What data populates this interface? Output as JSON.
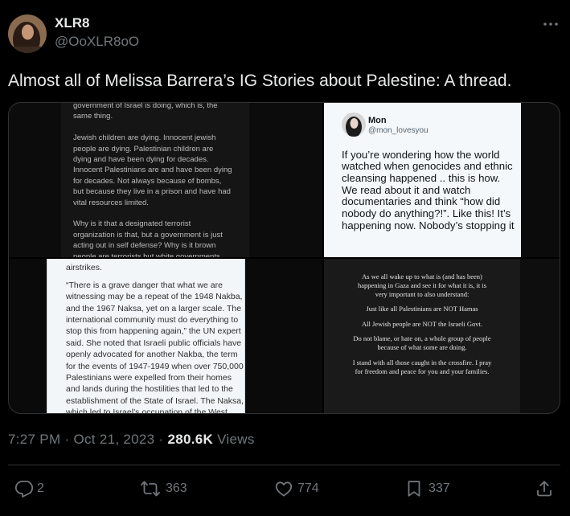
{
  "theme": {
    "background": "#000000",
    "text_primary": "#e7e9ea",
    "text_secondary": "#71767b",
    "border": "#2f3336"
  },
  "author": {
    "display_name": "XLR8",
    "handle": "@OoXLR8oO",
    "avatar_icon": "profile-photo"
  },
  "header": {
    "more_icon": "more-horizontal-icon"
  },
  "tweet": {
    "text": "Almost all of Melissa Barrera’s IG Stories about Palestine: A thread."
  },
  "media": {
    "image_1": {
      "paragraphs": [
        [
          "government of Israel is doing, which is, the",
          "same thing."
        ],
        [
          "Jewish children are dying. Innocent jewish",
          "people are dying. Palestinian children are",
          "dying and have been dying for decades.",
          "Innocent Palestinians are and have been dying",
          "for decades. Not always because of bombs,",
          "but because they live in a prison and have had",
          "vital resources limited."
        ],
        [
          "Why is it that a designated terrorist",
          "organization is that, but a government is just",
          "acting out in self defense? Why is it brown",
          "people are terrorists but white governments"
        ]
      ]
    },
    "image_2": {
      "author_name": "Mon",
      "author_handle": "@mon_lovesyou",
      "avatar_icon": "profile-photo",
      "lines": [
        "If you’re wondering how the world",
        "watched when genocides and ethnic",
        "cleansing happened .. this is how.",
        "We read about it and watch",
        "documentaries and think “how did",
        "nobody do anything?!”. Like this! It’s",
        "happening now. Nobody’s stopping it"
      ]
    },
    "image_3": {
      "lead": "airstrikes.",
      "lines": [
        "“There is a grave danger that what we are",
        "witnessing may be a repeat of the 1948 Nakba,",
        "and the 1967 Naksa, yet on a larger scale. The",
        "international community must do everything to",
        "stop this from happening again,” the UN expert",
        "said. She noted that Israeli public officials have",
        "openly advocated for another Nakba, the term",
        "for the events of 1947-1949 when over 750,000",
        "Palestinians were expelled from their homes",
        "and lands during the hostilities that led to the",
        "establishment of the State of Israel. The Naksa,",
        "which led to Israel’s occupation of the West"
      ]
    },
    "image_4": {
      "paragraphs": [
        [
          "As we all wake up to what is (and has been)",
          "happening in Gaza and see it for what it is, it is",
          "very important to also understand:"
        ],
        [
          "Just like all Palestinians are NOT Hamas"
        ],
        [
          "All Jewish people are NOT the Israeli Govt."
        ],
        [
          "Do not blame, or hate on, a whole group of people",
          "because of what some are doing."
        ],
        [
          "I stand with all those caught in the crossfire. I pray",
          "for freedom and peace for you and your families."
        ]
      ]
    }
  },
  "meta": {
    "time": "7:27 PM",
    "separator": "·",
    "date": "Oct 21, 2023",
    "views_count": "280.6K",
    "views_label": "Views"
  },
  "actions": {
    "reply": {
      "icon": "reply-icon",
      "count": "2"
    },
    "retweet": {
      "icon": "retweet-icon",
      "count": "363"
    },
    "like": {
      "icon": "heart-icon",
      "count": "774"
    },
    "bookmark": {
      "icon": "bookmark-icon",
      "count": "337"
    },
    "share": {
      "icon": "share-icon"
    }
  }
}
